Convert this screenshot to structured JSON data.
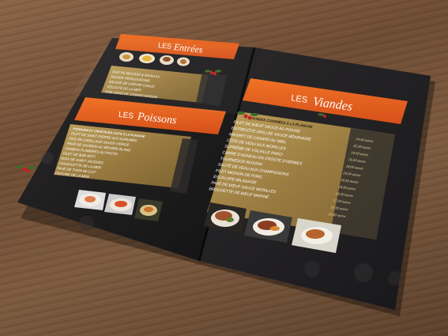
{
  "left_page": {
    "entrees": {
      "prefix": "LES",
      "title": "Entrées"
    },
    "entrees_items": [
      "DUO DE MOUSSE & GRAVLAX",
      "SALADE PÉRIGOURDINE",
      "SALADE DE CHÈVRE CHAUD",
      "VELOUTÉ DE LA MER",
      "FOIE GRAS DE CANARD MAISON"
    ],
    "poissons": {
      "prefix": "LES",
      "title": "Poissons"
    },
    "poissons_heading": "POISSONS ET CRUSTACÉS CUITS À LA PLANCHE",
    "poissons_items": [
      "FILET DE SAINT PIERRE AUX AGRUMES",
      "DOS DE CABILLAUD SAUCE VIERGE",
      "PAVÉ DE SAUMON AU BEURRE BLANC",
      "GAMBAS FLAMBÉES AU PASTIS",
      "FILET DE BAR RÔTI",
      "NOIX DE SAINT JACQUES",
      "CASSOLETTE DE LA MER",
      "PAVÉ DE THON MI-CUIT",
      "FRITURE DE LA MER"
    ]
  },
  "right_page": {
    "viandes": {
      "prefix": "LES",
      "title": "Viandes"
    },
    "viandes_heading": "VIANDES CUISINÉES À LA PLANCHE",
    "viandes_items": [
      "FILET DE BŒUF SAUCE AU POIVRE",
      "ENTRECÔTE GRILLÉE SAUCE BÉARNAISE",
      "MAGRET DE CANARD AU MIEL",
      "CÔTE DE VEAU AUX MORILLES",
      "SUPRÊME DE VOLAILLE FARCI",
      "CARRÉ D'AGNEAU EN CROÛTE D'HERBES",
      "TOURNEDOS ROSSINI",
      "SAUTÉ DE VEAU AUX CHAMPIGNONS",
      "FILET MIGNON DE PORC",
      "ESCALOPE MILANAISE",
      "PAVÉ DE BŒUF SAUCE MORILLES",
      "BROCHETTE DE BŒUF MARINÉ"
    ],
    "viandes_prices": [
      "24,50 euros",
      "22,00 euros",
      "19,50 euros",
      "23,00 euros",
      "18,00 euros",
      "26,00 euros",
      "28,50 euros",
      "19,00 euros",
      "18,50 euros",
      "17,00 euros",
      "22,50 euros",
      "20,00 euros"
    ]
  },
  "colors": {
    "banner_orange": "#e85f1c",
    "gold_panel": "#a88a4e",
    "page_dark": "#1f1d1e"
  }
}
